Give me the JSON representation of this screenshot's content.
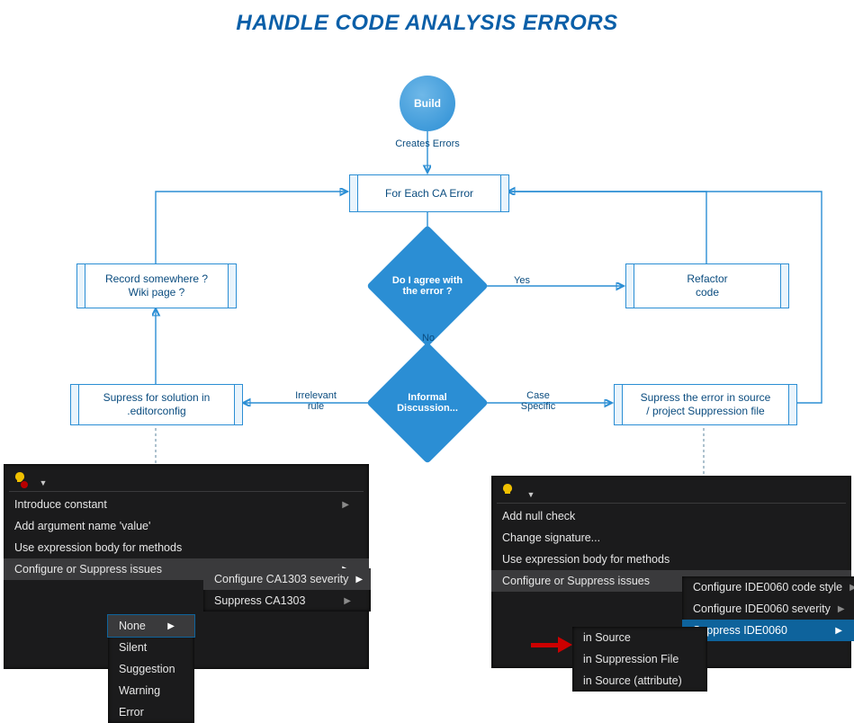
{
  "title": "HANDLE CODE ANALYSIS ERRORS",
  "nodes": {
    "build": "Build",
    "createsErrors": "Creates Errors",
    "forEach": "For Each CA Error",
    "agree": "Do I agree with the error ?",
    "refactor": "Refactor\ncode",
    "record": "Record somewhere ?\nWiki page ?",
    "discussion": "Informal Discussion...",
    "supSolution": "Supress for solution in\n.editorconfig",
    "supSource": "Supress the error in source\n/ project Suppression file"
  },
  "edges": {
    "yes": "Yes",
    "no": "No",
    "irrelevant": "Irrelevant\nrule",
    "caseSpecific": "Case\nSpecific"
  },
  "leftMenu": {
    "items": {
      "introConst": "Introduce constant",
      "addArg": "Add argument name 'value'",
      "exprBody": "Use expression body for methods",
      "configSup": "Configure or Suppress issues"
    },
    "sub1": {
      "cfgSeverity": "Configure CA1303 severity",
      "suppress": "Suppress CA1303"
    },
    "sub2": {
      "none": "None",
      "silent": "Silent",
      "suggestion": "Suggestion",
      "warning": "Warning",
      "error": "Error"
    }
  },
  "rightMenu": {
    "items": {
      "addNull": "Add null check",
      "changeSig": "Change signature...",
      "exprBody": "Use expression body for methods",
      "configSup": "Configure or Suppress issues"
    },
    "sub1": {
      "cfgStyle": "Configure IDE0060 code style",
      "cfgSeverity": "Configure IDE0060 severity",
      "suppress": "Suppress IDE0060"
    },
    "sub2": {
      "inSource": "in Source",
      "inSupFile": "in Suppression File",
      "inSourceAttr": "in Source (attribute)"
    }
  }
}
